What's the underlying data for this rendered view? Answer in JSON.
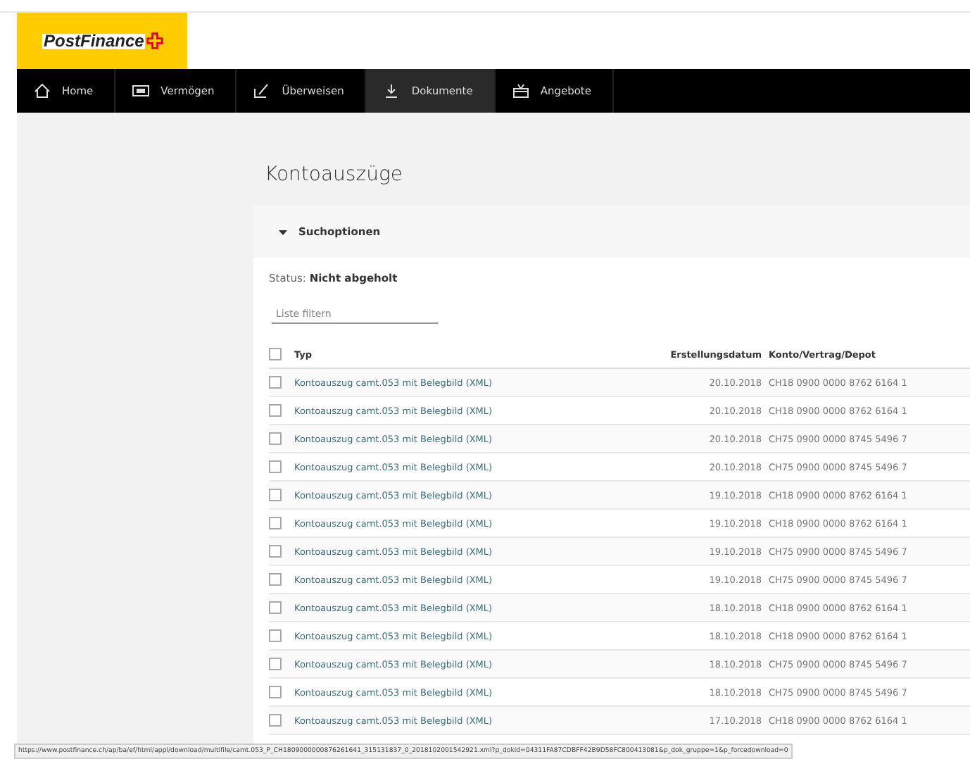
{
  "logo": {
    "text": "PostFinance"
  },
  "nav": [
    {
      "label": "Home",
      "selected": false
    },
    {
      "label": "Vermögen",
      "selected": false
    },
    {
      "label": "Überweisen",
      "selected": false
    },
    {
      "label": "Dokumente",
      "selected": true
    },
    {
      "label": "Angebote",
      "selected": false
    }
  ],
  "page_title": "Kontoauszüge",
  "search_options": {
    "label": "Suchoptionen",
    "expanded": true
  },
  "status": {
    "label": "Status:",
    "value": "Nicht abgeholt"
  },
  "filter": {
    "placeholder": "Liste filtern"
  },
  "table": {
    "columns": [
      "Typ",
      "Erstellungsdatum",
      "Konto/Vertrag/Depot"
    ],
    "select_all": {
      "checked": false
    },
    "rows": [
      {
        "checked": false,
        "type": "Kontoauszug camt.053 mit Belegbild (XML)",
        "date": "20.10.2018",
        "account": "CH18 0900 0000 8762 6164 1"
      },
      {
        "checked": false,
        "type": "Kontoauszug camt.053 mit Belegbild (XML)",
        "date": "20.10.2018",
        "account": "CH18 0900 0000 8762 6164 1"
      },
      {
        "checked": false,
        "type": "Kontoauszug camt.053 mit Belegbild (XML)",
        "date": "20.10.2018",
        "account": "CH75 0900 0000 8745 5496 7"
      },
      {
        "checked": false,
        "type": "Kontoauszug camt.053 mit Belegbild (XML)",
        "date": "20.10.2018",
        "account": "CH75 0900 0000 8745 5496 7"
      },
      {
        "checked": false,
        "type": "Kontoauszug camt.053 mit Belegbild (XML)",
        "date": "19.10.2018",
        "account": "CH18 0900 0000 8762 6164 1"
      },
      {
        "checked": false,
        "type": "Kontoauszug camt.053 mit Belegbild (XML)",
        "date": "19.10.2018",
        "account": "CH18 0900 0000 8762 6164 1"
      },
      {
        "checked": false,
        "type": "Kontoauszug camt.053 mit Belegbild (XML)",
        "date": "19.10.2018",
        "account": "CH75 0900 0000 8745 5496 7"
      },
      {
        "checked": false,
        "type": "Kontoauszug camt.053 mit Belegbild (XML)",
        "date": "19.10.2018",
        "account": "CH75 0900 0000 8745 5496 7"
      },
      {
        "checked": false,
        "type": "Kontoauszug camt.053 mit Belegbild (XML)",
        "date": "18.10.2018",
        "account": "CH18 0900 0000 8762 6164 1"
      },
      {
        "checked": false,
        "type": "Kontoauszug camt.053 mit Belegbild (XML)",
        "date": "18.10.2018",
        "account": "CH18 0900 0000 8762 6164 1"
      },
      {
        "checked": false,
        "type": "Kontoauszug camt.053 mit Belegbild (XML)",
        "date": "18.10.2018",
        "account": "CH75 0900 0000 8745 5496 7"
      },
      {
        "checked": false,
        "type": "Kontoauszug camt.053 mit Belegbild (XML)",
        "date": "18.10.2018",
        "account": "CH75 0900 0000 8745 5496 7"
      },
      {
        "checked": false,
        "type": "Kontoauszug camt.053 mit Belegbild (XML)",
        "date": "17.10.2018",
        "account": "CH18 0900 0000 8762 6164 1"
      }
    ]
  },
  "status_bar": "https://www.postfinance.ch/ap/ba/ef/html/appl/download/multifile/camt.053_P_CH1809000000876261641_315131837_0_2018102001542921.xml?p_dokid=04311FA87CDBFF42B9D58FC800413081&p_dok_gruppe=1&p_forcedownload=0"
}
